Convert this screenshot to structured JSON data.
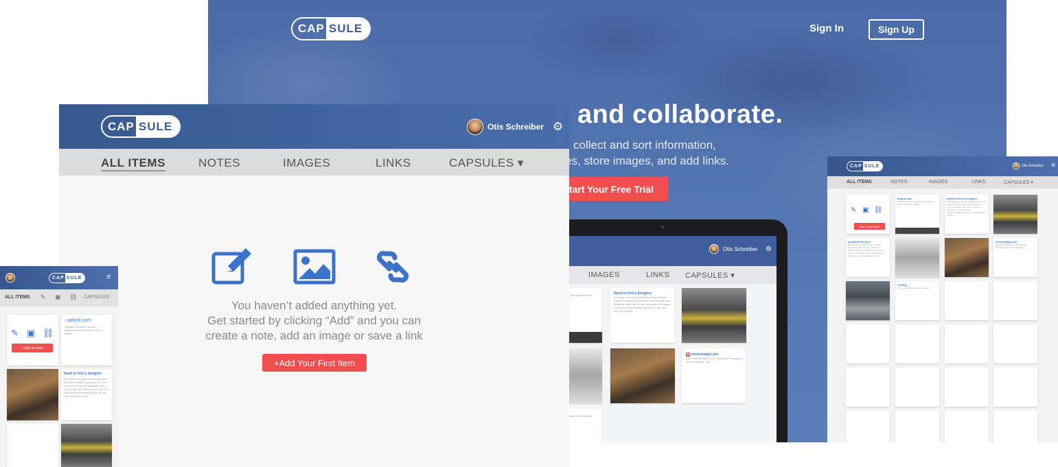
{
  "hero": {
    "logo_left": "CAP",
    "logo_right": "SULE",
    "sign_in": "Sign In",
    "sign_up": "Sign Up",
    "headline": "and collaborate.",
    "sub_line1": "collect and sort information,",
    "sub_line2": "es, store images, and add links.",
    "cta": "tart Your Free Trial",
    "laptop": {
      "user_name": "Otis Schreiber",
      "nav": [
        "IMAGES",
        "LINKS",
        "CAPSULES ▾"
      ],
      "card1_text": "ney Apartments & ",
      "card2_title": "Need to find a designer",
      "card2_text": "We have a one person design team but are ready to expand! We need to hire for a second designer right now so we can continue to grow. Put your recommendations here so we can view all of them.",
      "card3_title": "invisionapp.com",
      "card3_text": "Free Web & Mobile (iOS, Android) Prototyping and UI Mockup Tool",
      "card4_text": "sual event Review"
    }
  },
  "main": {
    "logo_left": "CAP",
    "logo_right": "SULE",
    "user_name": "Otis Schreiber",
    "tabs": [
      "ALL ITEMS",
      "NOTES",
      "IMAGES",
      "LINKS",
      "CAPSULES ▾"
    ],
    "empty_line1": "You haven’t added anything yet.",
    "empty_line2": "Get started by clicking “Add” and you can",
    "empty_line3": "create a note, add an image or save a link",
    "add_button": "+Add Your First Item"
  },
  "mobile": {
    "logo_left": "CAP",
    "logo_right": "SULE",
    "nav_all": "ALL ITEMS",
    "nav_capsules": "CAPSULES",
    "add_button": "+ Add an Item",
    "link_title": "airbnb.com",
    "link_text": "Vacation Rentals, Homes, Apartments & Rooms for Rent - Airbnb",
    "note_title": "Need to find a designer",
    "note_text": "We have a one person design team but we're ready to expand. We need to hire for a second designer right now so we can continue to grow. Put your recommendations here so we can view all of them."
  },
  "desk": {
    "logo_left": "CAP",
    "logo_right": "SULE",
    "user_name": "Otis Schreiber",
    "tabs": [
      "ALL ITEMS",
      "NOTES",
      "IMAGES",
      "LINKS",
      "CAPSULES ▾"
    ],
    "add_button": "Add a New Note",
    "card_airbnb_title": "airbnb.com",
    "card_airbnb_text": "Vacation Rentals, Homes, Apartments & Rooms for Rent - Airbnb",
    "card_designer_title": "Need to find a designer",
    "card_designer_text": "We have a one person design team but are ready to expand. We need to hire for a second designer right now so we can continue to grow. Put your recommendations here so we can view all of them.",
    "card_product_title": "producthunt.com",
    "card_product_text": "Product Hunt surfaces the best new products, every day. It's a place for product-loving enthusiasts to share and geek out about the latest mobile apps, websites, and technology products.",
    "card_invision_title": "invisionapp.com",
    "card_invision_text": "Free Web & Mobile (iOS, Android) Prototyping and UI Mockup Tool",
    "card_testing_title": "Testing",
    "card_testing_text": "This is another note just for review."
  },
  "colors": {
    "brand_blue": "#3d5c9a",
    "accent_red": "#f24e50",
    "icon_blue": "#3d72c9"
  }
}
